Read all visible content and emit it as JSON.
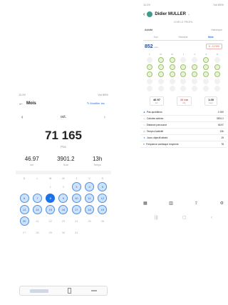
{
  "left": {
    "status_time": "11:29",
    "status_right": "Vol 85%",
    "header": {
      "back_icon": "arrow-left-icon",
      "title": "Mois",
      "edit_label": "Modifier les"
    },
    "month": {
      "label": "oct.",
      "prev_icon": "chevron-left-icon",
      "next_icon": "chevron-right-icon"
    },
    "hero": {
      "value": "71 165",
      "unit": "Pas"
    },
    "stats": [
      {
        "value": "46.97",
        "label": "km"
      },
      {
        "value": "3901.2",
        "label": "Kcal"
      },
      {
        "value": "13h",
        "label": "Temps"
      }
    ],
    "weekdays": [
      "D",
      "L",
      "M",
      "M",
      "J",
      "V",
      "S"
    ],
    "calendar": [
      {
        "d": "",
        "s": "blank"
      },
      {
        "d": "",
        "s": "blank"
      },
      {
        "d": "1",
        "s": "off"
      },
      {
        "d": "2",
        "s": "off"
      },
      {
        "d": "3",
        "s": "on"
      },
      {
        "d": "4",
        "s": "on"
      },
      {
        "d": "5",
        "s": "on"
      },
      {
        "d": "6",
        "s": "on"
      },
      {
        "d": "7",
        "s": "on"
      },
      {
        "d": "8",
        "s": "today"
      },
      {
        "d": "9",
        "s": "on"
      },
      {
        "d": "10",
        "s": "on"
      },
      {
        "d": "11",
        "s": "on"
      },
      {
        "d": "12",
        "s": "on"
      },
      {
        "d": "13",
        "s": "on"
      },
      {
        "d": "14",
        "s": "on"
      },
      {
        "d": "15",
        "s": "on"
      },
      {
        "d": "16",
        "s": "on"
      },
      {
        "d": "17",
        "s": "on"
      },
      {
        "d": "18",
        "s": "on"
      },
      {
        "d": "19",
        "s": "on"
      },
      {
        "d": "20",
        "s": "on"
      },
      {
        "d": "21",
        "s": "off"
      },
      {
        "d": "22",
        "s": "off"
      },
      {
        "d": "23",
        "s": "off"
      },
      {
        "d": "24",
        "s": "off"
      },
      {
        "d": "25",
        "s": "off"
      },
      {
        "d": "26",
        "s": "off"
      },
      {
        "d": "27",
        "s": "off"
      },
      {
        "d": "28",
        "s": "off"
      },
      {
        "d": "29",
        "s": "off"
      },
      {
        "d": "30",
        "s": "off"
      },
      {
        "d": "31",
        "s": "off"
      },
      {
        "d": "",
        "s": "blank"
      },
      {
        "d": "",
        "s": "blank"
      }
    ],
    "bottom_bar": {
      "icons": [
        "card-icon",
        "phone-icon",
        "menu-icon"
      ]
    }
  },
  "right": {
    "status_time": "11:29",
    "status_right": "Vol 85%",
    "header": {
      "back_icon": "chevron-left-icon",
      "avatar_icon": "avatar-icon",
      "name": "Didier MULLER",
      "dropdown_icon": "chevron-down-icon"
    },
    "subheader": "VOIR LE PROFIL",
    "section_left": "Activité",
    "section_right": "Historique",
    "tabs": [
      "Jour",
      "Semaine",
      "Mois"
    ],
    "summary": {
      "big": "852",
      "big_label": "pas",
      "target": "6 - 12 000"
    },
    "mini_calendar_weekdays": [
      "L",
      "M",
      "M",
      "J",
      "V",
      "S",
      "D"
    ],
    "mini_calendar": [
      "e",
      "g",
      "g",
      "e",
      "e",
      "g",
      "e",
      "g",
      "g",
      "g",
      "g",
      "g",
      "g",
      "g",
      "g",
      "g",
      "g",
      "g",
      "g",
      "g",
      "g",
      "e",
      "e",
      "e",
      "e",
      "e",
      "e",
      "e",
      "e",
      "e",
      "e",
      "e",
      "e",
      "e",
      "e"
    ],
    "metrics": [
      {
        "value": "46 97",
        "label": "km"
      },
      {
        "value": "10 km",
        "label": "obj."
      },
      {
        "value": "1.00",
        "label": "moy."
      }
    ],
    "list": [
      {
        "icon": "walk-icon",
        "label": "Pas quotidiens",
        "value": "1 000"
      },
      {
        "icon": "flame-icon",
        "label": "Calories actives",
        "value": "3901.2"
      },
      {
        "icon": "route-icon",
        "label": "Distance parcourue",
        "value": "46.97"
      },
      {
        "icon": "clock-icon",
        "label": "Temps d'activité",
        "value": "13h"
      },
      {
        "icon": "trophy-icon",
        "label": "Jours objectif atteint",
        "value": "19"
      },
      {
        "icon": "heart-icon",
        "label": "Fréquence cardiaque moyenne",
        "value": "78"
      }
    ],
    "bottom_icons": [
      "calendar-icon",
      "chart-icon",
      "share-icon",
      "settings-icon"
    ],
    "nav_icons": [
      "recent-apps-icon",
      "home-icon",
      "back-icon"
    ]
  }
}
